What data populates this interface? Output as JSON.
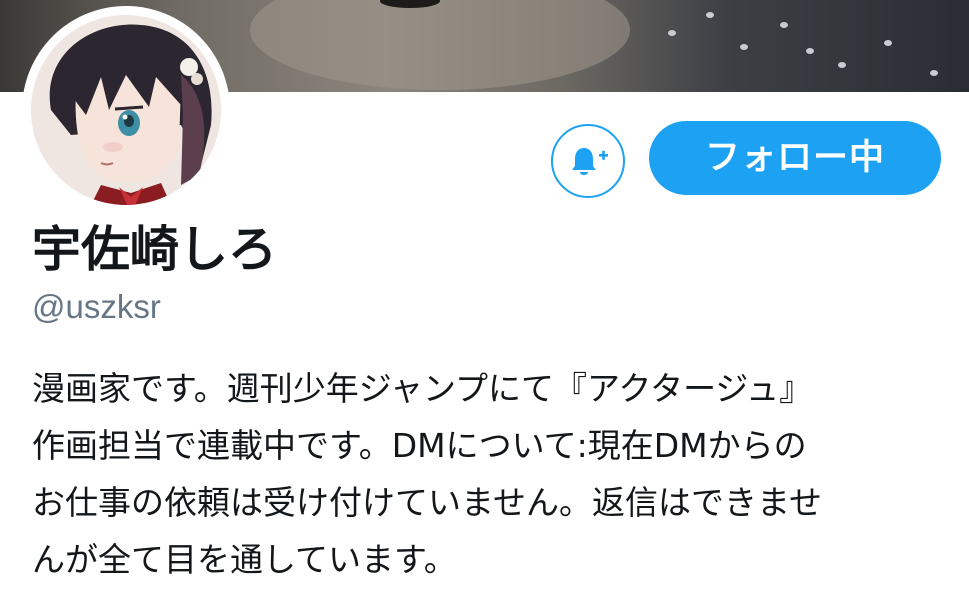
{
  "profile": {
    "display_name": "宇佐崎しろ",
    "screen_name": "@uszksr",
    "bio_lines": [
      "漫画家です。週刊少年ジャンプにて『アクタージュ』",
      "作画担当で連載中です。DMについて:現在DMからの",
      "お仕事の依頼は受け付けていません。返信はできませ",
      "んが全て目を通しています。"
    ]
  },
  "actions": {
    "follow_label": "フォロー中",
    "notification_icon": "bell-plus-icon"
  },
  "colors": {
    "accent": "#1da1f2",
    "text_primary": "#14171a",
    "text_secondary": "#657786"
  }
}
